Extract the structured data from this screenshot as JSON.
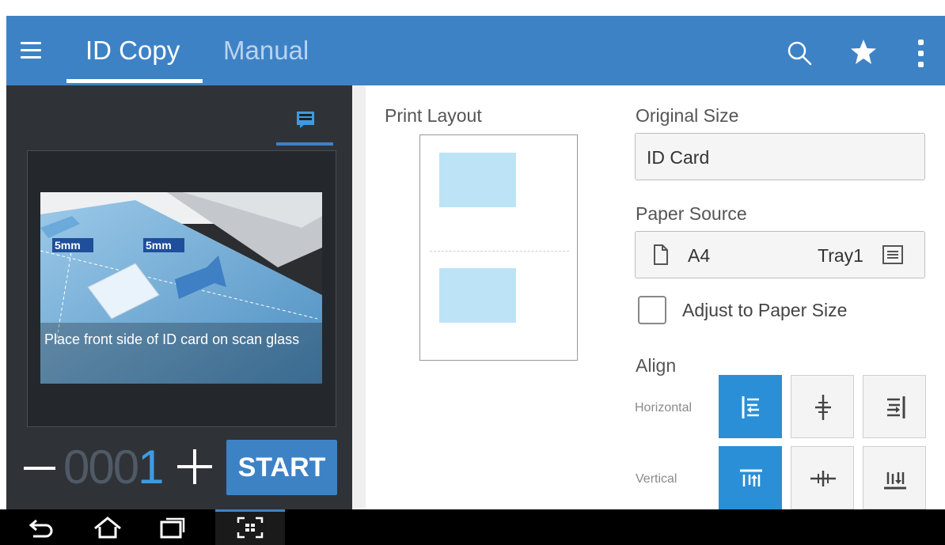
{
  "appbar": {
    "tabs": [
      {
        "label": "ID Copy",
        "active": true
      },
      {
        "label": "Manual",
        "active": false
      }
    ],
    "icons": [
      "menu-icon",
      "search-icon",
      "star-icon",
      "more-vert-icon"
    ],
    "color": "#3e82c6"
  },
  "preview": {
    "caption": "Place front side of ID card on scan glass",
    "margin_label_1": "5mm",
    "margin_label_2": "5mm"
  },
  "counter": {
    "dim_digits": "000",
    "active_digit": "1"
  },
  "start_label": "START",
  "print_layout": {
    "label": "Print Layout"
  },
  "original_size": {
    "label": "Original Size",
    "value": "ID Card"
  },
  "paper_source": {
    "label": "Paper Source",
    "paper": "A4",
    "tray": "Tray1"
  },
  "adjust": {
    "label": "Adjust to Paper Size",
    "checked": false
  },
  "align": {
    "label": "Align",
    "horizontal_label": "Horizontal",
    "vertical_label": "Vertical"
  },
  "system_nav": [
    "back-icon",
    "home-icon",
    "recent-apps-icon",
    "screen-capture-icon"
  ]
}
